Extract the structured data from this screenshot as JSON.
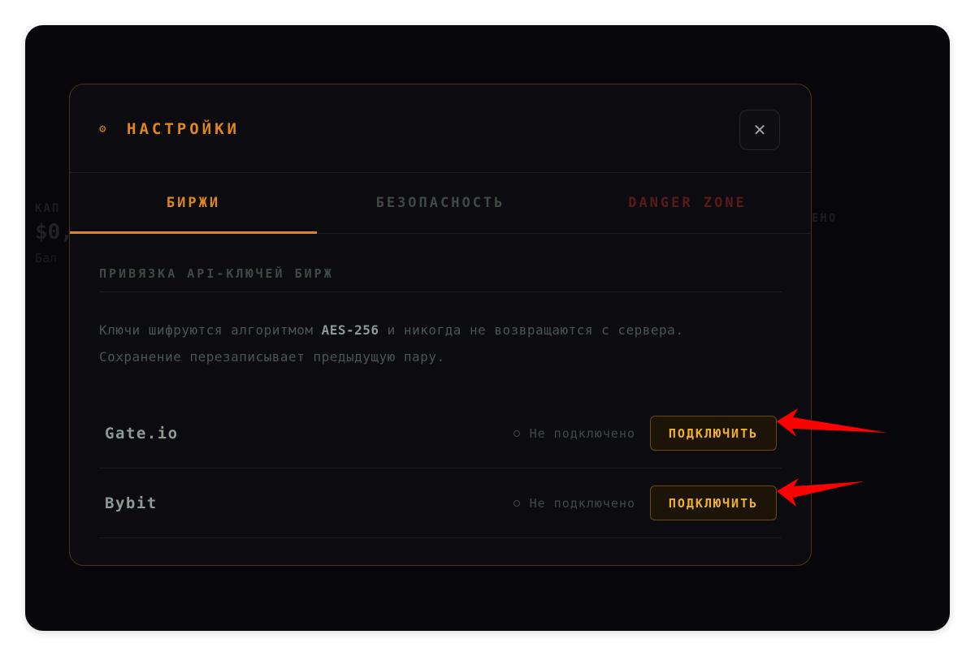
{
  "background": {
    "left_card": {
      "label": "КАП",
      "value": "$0,",
      "sub": "Бал"
    },
    "right_card": {
      "label": "ЕНО"
    }
  },
  "modal": {
    "title": "НАСТРОЙКИ",
    "icon": "gear-icon",
    "close_label": "✕",
    "tabs": [
      {
        "label": "БИРЖИ",
        "active": true
      },
      {
        "label": "БЕЗОПАСНОСТЬ",
        "active": false
      },
      {
        "label": "DANGER ZONE",
        "active": false
      }
    ],
    "section_title": "ПРИВЯЗКА API-КЛЮЧЕЙ БИРЖ",
    "description": {
      "prefix": "Ключи шифруются алгоритмом ",
      "highlight": "AES-256",
      "suffix": " и никогда не возвращаются с сервера.",
      "line2": "Сохранение перезаписывает предыдущую пару."
    },
    "exchanges": [
      {
        "name": "Gate.io",
        "status": "Не подключено",
        "button": "ПОДКЛЮЧИТЬ"
      },
      {
        "name": "Bybit",
        "status": "Не подключено",
        "button": "ПОДКЛЮЧИТЬ"
      }
    ]
  },
  "colors": {
    "accent": "#e0861d",
    "button_text": "#f0b030",
    "danger": "#5a1a1a",
    "annotation_arrow": "#ff0000"
  }
}
